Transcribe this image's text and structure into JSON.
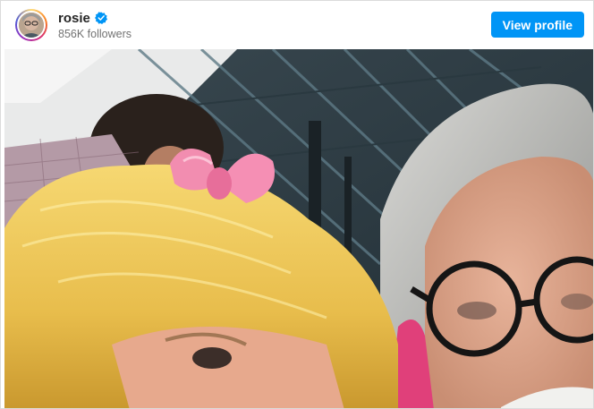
{
  "profile": {
    "username": "rosie",
    "followers": "856K followers",
    "verified": true,
    "avatar_icon": "profile-photo",
    "verified_icon": "verified-badge-icon"
  },
  "actions": {
    "view_profile_label": "View profile"
  },
  "colors": {
    "accent": "#0095f6",
    "username_text": "#262626",
    "secondary_text": "#737373",
    "border": "#dbdbdb"
  }
}
